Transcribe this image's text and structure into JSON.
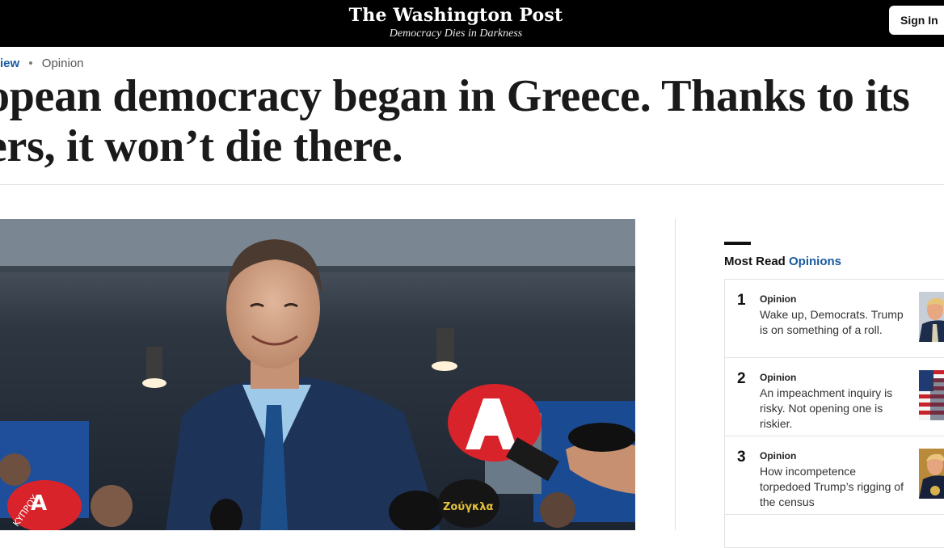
{
  "header": {
    "logo": "The Washington Post",
    "tagline": "Democracy Dies in Darkness",
    "sign_in": "Sign In"
  },
  "breadcrumb": {
    "section": "iew",
    "separator": "•",
    "category": "Opinion"
  },
  "article": {
    "headline_line1": "opean democracy began in Greece. Thanks to its",
    "headline_line2": "ers, it won’t die there.",
    "photo": {
      "microphone_logos": [
        "A",
        "ΚΥΠΡΟΥ",
        "Ζούγκλα"
      ]
    }
  },
  "most_read": {
    "title": "Most Read",
    "title_accent": "Opinions",
    "items": [
      {
        "num": "1",
        "kicker": "Opinion",
        "text": "Wake up, Democrats. Trump is on something of a roll."
      },
      {
        "num": "2",
        "kicker": "Opinion",
        "text": "An impeachment inquiry is risky. Not opening one is riskier."
      },
      {
        "num": "3",
        "kicker": "Opinion",
        "text": "How incompetence torpedoed Trump’s rigging of the census"
      }
    ]
  },
  "colors": {
    "accent": "#1a5aa0",
    "topbar": "#000000",
    "mic_red": "#d8232a"
  }
}
